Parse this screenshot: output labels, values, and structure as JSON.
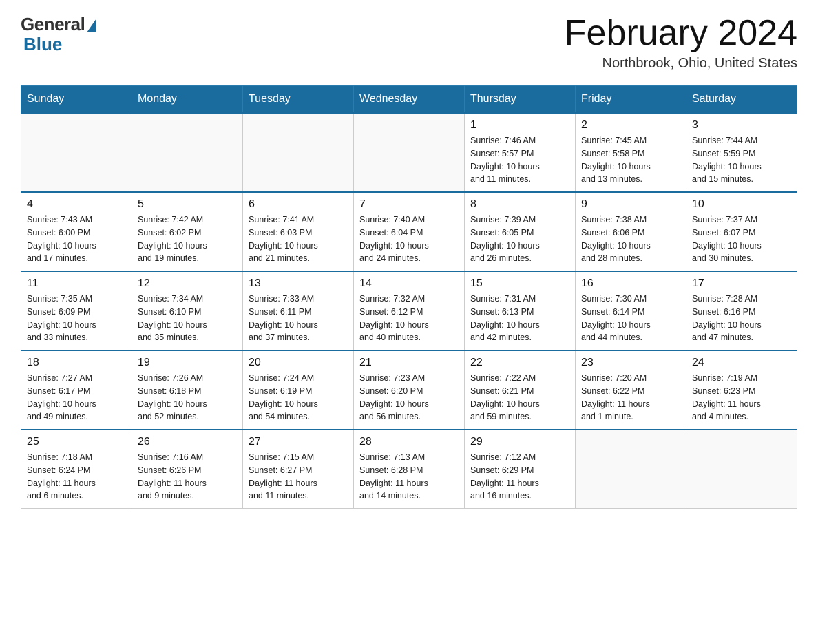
{
  "logo": {
    "general": "General",
    "blue": "Blue"
  },
  "title": "February 2024",
  "location": "Northbrook, Ohio, United States",
  "days_of_week": [
    "Sunday",
    "Monday",
    "Tuesday",
    "Wednesday",
    "Thursday",
    "Friday",
    "Saturday"
  ],
  "weeks": [
    [
      {
        "day": "",
        "info": ""
      },
      {
        "day": "",
        "info": ""
      },
      {
        "day": "",
        "info": ""
      },
      {
        "day": "",
        "info": ""
      },
      {
        "day": "1",
        "info": "Sunrise: 7:46 AM\nSunset: 5:57 PM\nDaylight: 10 hours\nand 11 minutes."
      },
      {
        "day": "2",
        "info": "Sunrise: 7:45 AM\nSunset: 5:58 PM\nDaylight: 10 hours\nand 13 minutes."
      },
      {
        "day": "3",
        "info": "Sunrise: 7:44 AM\nSunset: 5:59 PM\nDaylight: 10 hours\nand 15 minutes."
      }
    ],
    [
      {
        "day": "4",
        "info": "Sunrise: 7:43 AM\nSunset: 6:00 PM\nDaylight: 10 hours\nand 17 minutes."
      },
      {
        "day": "5",
        "info": "Sunrise: 7:42 AM\nSunset: 6:02 PM\nDaylight: 10 hours\nand 19 minutes."
      },
      {
        "day": "6",
        "info": "Sunrise: 7:41 AM\nSunset: 6:03 PM\nDaylight: 10 hours\nand 21 minutes."
      },
      {
        "day": "7",
        "info": "Sunrise: 7:40 AM\nSunset: 6:04 PM\nDaylight: 10 hours\nand 24 minutes."
      },
      {
        "day": "8",
        "info": "Sunrise: 7:39 AM\nSunset: 6:05 PM\nDaylight: 10 hours\nand 26 minutes."
      },
      {
        "day": "9",
        "info": "Sunrise: 7:38 AM\nSunset: 6:06 PM\nDaylight: 10 hours\nand 28 minutes."
      },
      {
        "day": "10",
        "info": "Sunrise: 7:37 AM\nSunset: 6:07 PM\nDaylight: 10 hours\nand 30 minutes."
      }
    ],
    [
      {
        "day": "11",
        "info": "Sunrise: 7:35 AM\nSunset: 6:09 PM\nDaylight: 10 hours\nand 33 minutes."
      },
      {
        "day": "12",
        "info": "Sunrise: 7:34 AM\nSunset: 6:10 PM\nDaylight: 10 hours\nand 35 minutes."
      },
      {
        "day": "13",
        "info": "Sunrise: 7:33 AM\nSunset: 6:11 PM\nDaylight: 10 hours\nand 37 minutes."
      },
      {
        "day": "14",
        "info": "Sunrise: 7:32 AM\nSunset: 6:12 PM\nDaylight: 10 hours\nand 40 minutes."
      },
      {
        "day": "15",
        "info": "Sunrise: 7:31 AM\nSunset: 6:13 PM\nDaylight: 10 hours\nand 42 minutes."
      },
      {
        "day": "16",
        "info": "Sunrise: 7:30 AM\nSunset: 6:14 PM\nDaylight: 10 hours\nand 44 minutes."
      },
      {
        "day": "17",
        "info": "Sunrise: 7:28 AM\nSunset: 6:16 PM\nDaylight: 10 hours\nand 47 minutes."
      }
    ],
    [
      {
        "day": "18",
        "info": "Sunrise: 7:27 AM\nSunset: 6:17 PM\nDaylight: 10 hours\nand 49 minutes."
      },
      {
        "day": "19",
        "info": "Sunrise: 7:26 AM\nSunset: 6:18 PM\nDaylight: 10 hours\nand 52 minutes."
      },
      {
        "day": "20",
        "info": "Sunrise: 7:24 AM\nSunset: 6:19 PM\nDaylight: 10 hours\nand 54 minutes."
      },
      {
        "day": "21",
        "info": "Sunrise: 7:23 AM\nSunset: 6:20 PM\nDaylight: 10 hours\nand 56 minutes."
      },
      {
        "day": "22",
        "info": "Sunrise: 7:22 AM\nSunset: 6:21 PM\nDaylight: 10 hours\nand 59 minutes."
      },
      {
        "day": "23",
        "info": "Sunrise: 7:20 AM\nSunset: 6:22 PM\nDaylight: 11 hours\nand 1 minute."
      },
      {
        "day": "24",
        "info": "Sunrise: 7:19 AM\nSunset: 6:23 PM\nDaylight: 11 hours\nand 4 minutes."
      }
    ],
    [
      {
        "day": "25",
        "info": "Sunrise: 7:18 AM\nSunset: 6:24 PM\nDaylight: 11 hours\nand 6 minutes."
      },
      {
        "day": "26",
        "info": "Sunrise: 7:16 AM\nSunset: 6:26 PM\nDaylight: 11 hours\nand 9 minutes."
      },
      {
        "day": "27",
        "info": "Sunrise: 7:15 AM\nSunset: 6:27 PM\nDaylight: 11 hours\nand 11 minutes."
      },
      {
        "day": "28",
        "info": "Sunrise: 7:13 AM\nSunset: 6:28 PM\nDaylight: 11 hours\nand 14 minutes."
      },
      {
        "day": "29",
        "info": "Sunrise: 7:12 AM\nSunset: 6:29 PM\nDaylight: 11 hours\nand 16 minutes."
      },
      {
        "day": "",
        "info": ""
      },
      {
        "day": "",
        "info": ""
      }
    ]
  ]
}
